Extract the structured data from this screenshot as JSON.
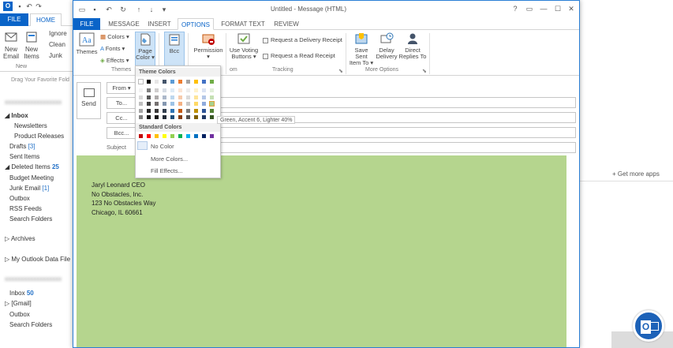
{
  "main": {
    "tabs": {
      "file": "FILE",
      "home": "HOME"
    },
    "ribbon": {
      "new_email": "New\nEmail",
      "new_items": "New\nItems",
      "ignore": "Ignore",
      "clean_up": "Clean",
      "junk": "Junk",
      "group_new": "New"
    },
    "nav": {
      "favorites_hint": "Drag Your Favorite Fold",
      "account_blurred": "xxxxxxxxxxxxxxxxxx",
      "inbox": "Inbox",
      "newsletters": "Newsletters",
      "product_releases": "Product Releases",
      "drafts": "Drafts",
      "drafts_count": "[3]",
      "sent_items": "Sent Items",
      "deleted_items": "Deleted Items",
      "deleted_count": "25",
      "budget_meeting": "Budget Meeting",
      "junk_email": "Junk Email",
      "junk_count": "[1]",
      "outbox": "Outbox",
      "rss_feeds": "RSS Feeds",
      "search_folders": "Search Folders",
      "archives": "Archives",
      "my_outlook_data": "My Outlook Data File",
      "account2_blurred": "xxxxxxxxxxxxxxxxxx",
      "inbox2": "Inbox",
      "inbox2_count": "50",
      "gmail": "[Gmail]",
      "outbox2": "Outbox",
      "search_folders2": "Search Folders"
    },
    "right": {
      "get_more_apps": "Get more apps"
    }
  },
  "message": {
    "title": "Untitled - Message (HTML)",
    "window_controls": {
      "help": "?",
      "restore": "▭",
      "minimize": "—",
      "maximize": "☐",
      "close": "✕"
    },
    "tabs": {
      "file": "FILE",
      "message": "MESSAGE",
      "insert": "INSERT",
      "options": "OPTIONS",
      "format_text": "FORMAT TEXT",
      "review": "REVIEW"
    },
    "ribbon": {
      "themes": "Themes",
      "colors": "Colors",
      "fonts": "Fonts",
      "effects": "Effects",
      "page_color_1": "Page",
      "page_color_2": "Color",
      "bcc": "Bcc",
      "permission": "Permission",
      "use_voting_1": "Use Voting",
      "use_voting_2": "Buttons",
      "request_delivery": "Request a Delivery Receipt",
      "request_read": "Request a Read Receipt",
      "save_sent_1": "Save Sent",
      "save_sent_2": "Item To",
      "delay_1": "Delay",
      "delay_2": "Delivery",
      "direct_1": "Direct",
      "direct_2": "Replies To",
      "group_themes": "Themes",
      "group_tracking": "Tracking",
      "group_more_options": "More Options",
      "from_hint": "om"
    },
    "fields": {
      "send": "Send",
      "from": "From",
      "to": "To...",
      "cc": "Cc...",
      "bcc": "Bcc...",
      "subject": "Subject"
    },
    "body": {
      "line1": "Jaryl Leonard CEO",
      "line2": "No Obstacles, Inc.",
      "line3": "123 No Obstacles Way",
      "line4": "Chicago, IL 60661",
      "background": "#b5d58e"
    }
  },
  "page_color_menu": {
    "theme_colors_label": "Theme Colors",
    "standard_colors_label": "Standard Colors",
    "no_color": "No Color",
    "more_colors": "More Colors...",
    "fill_effects": "Fill Effects...",
    "tooltip": "Green, Accent 6, Lighter 40%",
    "theme_top_row": [
      "#ffffff",
      "#000000",
      "#e7e6e6",
      "#44546a",
      "#5b9bd5",
      "#ed7d31",
      "#a5a5a5",
      "#ffc000",
      "#4472c4",
      "#70ad47"
    ],
    "theme_shades": [
      [
        "#f2f2f2",
        "#d9d9d9",
        "#bfbfbf",
        "#a6a6a6",
        "#808080"
      ],
      [
        "#7f7f7f",
        "#595959",
        "#404040",
        "#262626",
        "#0d0d0d"
      ],
      [
        "#d0cece",
        "#aeabab",
        "#757171",
        "#3a3838",
        "#171616"
      ],
      [
        "#d6dce4",
        "#adb9ca",
        "#8497b0",
        "#333f4f",
        "#222a35"
      ],
      [
        "#deebf6",
        "#bdd7ee",
        "#9dc3e6",
        "#2e75b5",
        "#1f4e79"
      ],
      [
        "#fbe5d5",
        "#f7cbac",
        "#f4b183",
        "#c55a11",
        "#843c0c"
      ],
      [
        "#ededed",
        "#dbdbdb",
        "#c9c9c9",
        "#7b7b7b",
        "#525252"
      ],
      [
        "#fff2cc",
        "#fee599",
        "#ffd965",
        "#bf9000",
        "#7f6000"
      ],
      [
        "#dae3f3",
        "#b4c7e7",
        "#8faadc",
        "#2f5597",
        "#203864"
      ],
      [
        "#e2efd9",
        "#c5e0b3",
        "#a8d08d",
        "#538135",
        "#375623"
      ]
    ],
    "standard_row": [
      "#c00000",
      "#ff0000",
      "#ffc000",
      "#ffff00",
      "#92d050",
      "#00b050",
      "#00b0f0",
      "#0070c0",
      "#002060",
      "#7030a0"
    ]
  }
}
